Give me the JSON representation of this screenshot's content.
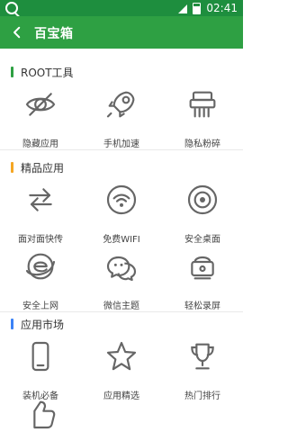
{
  "status_bar": {
    "time": "02:41"
  },
  "app_bar": {
    "title": "百宝箱"
  },
  "sections": [
    {
      "title": "ROOT工具",
      "bar_color": "#2ea043",
      "items": [
        {
          "label": "隐藏应用",
          "icon": "hidden-eye-icon"
        },
        {
          "label": "手机加速",
          "icon": "rocket-icon"
        },
        {
          "label": "隐私粉碎",
          "icon": "shredder-icon"
        }
      ]
    },
    {
      "title": "精品应用",
      "bar_color": "#f5a623",
      "items": [
        {
          "label": "面对面快传",
          "icon": "transfer-arrows-icon"
        },
        {
          "label": "免费WIFI",
          "icon": "wifi-icon"
        },
        {
          "label": "安全桌面",
          "icon": "desktop-circle-icon"
        },
        {
          "label": "安全上网",
          "icon": "browser-e-icon"
        },
        {
          "label": "微信主题",
          "icon": "wechat-icon"
        },
        {
          "label": "轻松录屏",
          "icon": "screen-recorder-icon"
        }
      ]
    },
    {
      "title": "应用市场",
      "bar_color": "#3b82f6",
      "items": [
        {
          "label": "装机必备",
          "icon": "phone-icon"
        },
        {
          "label": "应用精选",
          "icon": "star-icon"
        },
        {
          "label": "热门排行",
          "icon": "trophy-icon"
        },
        {
          "label": "",
          "icon": "thumbs-up-icon"
        }
      ]
    }
  ]
}
